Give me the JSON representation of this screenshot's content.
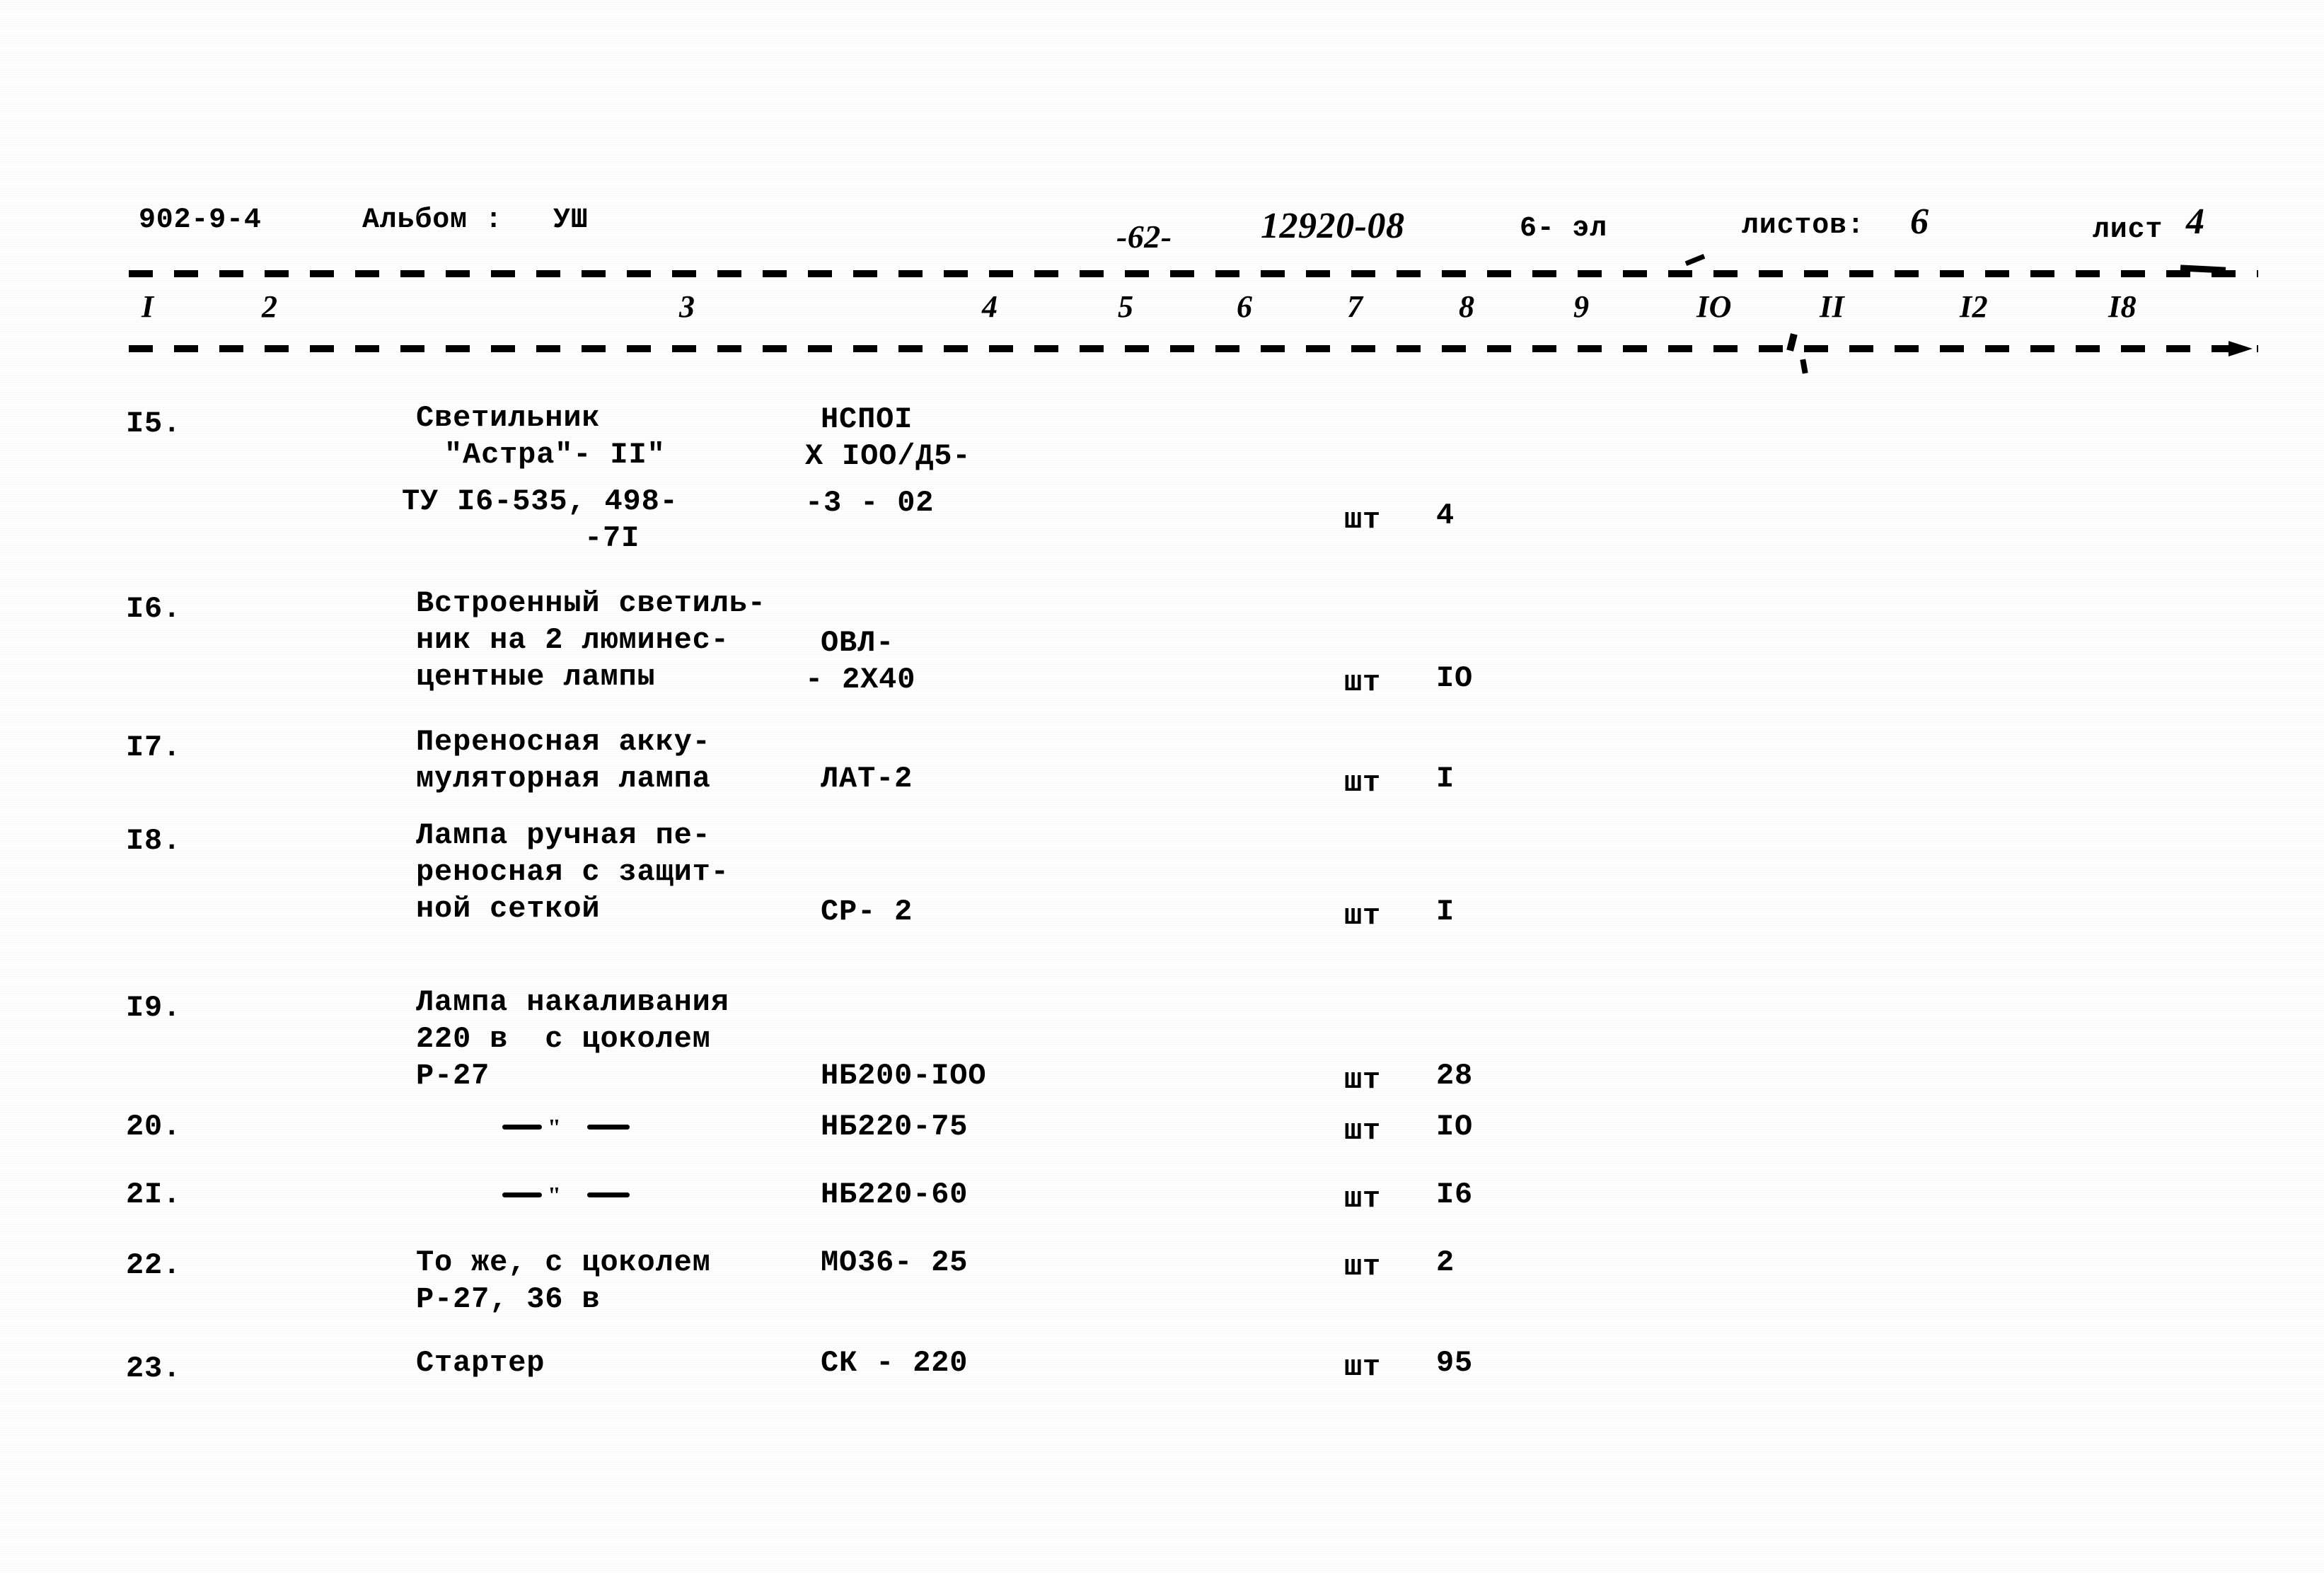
{
  "header": {
    "drawing_code": "902-9-4",
    "album_label": "Альбом :",
    "album_value": "УШ",
    "page_marker": "-62-",
    "order_number": "12920-08",
    "section": "6- эл",
    "sheets_label": "листов:",
    "sheets_value": "6",
    "sheet_label": "лист",
    "sheet_value": "4"
  },
  "column_numbers": [
    "I",
    "2",
    "3",
    "4",
    "5",
    "6",
    "7",
    "8",
    "9",
    "IO",
    "II",
    "I2",
    "I8"
  ],
  "unit_default": "шт",
  "ditto_mark": "\"",
  "rows": [
    {
      "no": "I5.",
      "name_lines": [
        "Светильник",
        "\"Астра\"- II\"",
        "ТУ I6-535, 498-",
        "-7I"
      ],
      "type_lines": [
        "НСПOI",
        "X IOO/Д5-",
        "-3 - 02"
      ],
      "unit": "шт",
      "qty": "4"
    },
    {
      "no": "I6.",
      "name_lines": [
        "Встроенный светиль-",
        "ник на 2 люминес-",
        "центные лампы"
      ],
      "type_lines": [
        "ОВЛ-",
        "- 2Х40"
      ],
      "unit": "шт",
      "qty": "IO"
    },
    {
      "no": "I7.",
      "name_lines": [
        "Переносная акку-",
        "муляторная лампа"
      ],
      "type_lines": [
        "ЛАТ-2"
      ],
      "unit": "шт",
      "qty": "I"
    },
    {
      "no": "I8.",
      "name_lines": [
        "Лампа ручная пе-",
        "реносная с защит-",
        "ной сеткой"
      ],
      "type_lines": [
        "СР- 2"
      ],
      "unit": "шт",
      "qty": "I"
    },
    {
      "no": "I9.",
      "name_lines": [
        "Лампа накаливания",
        "220 в  с цоколем",
        "Р-27"
      ],
      "type_lines": [
        "НБ200-IOO"
      ],
      "unit": "шт",
      "qty": "28"
    },
    {
      "no": "20.",
      "name_lines": [
        "—\"—"
      ],
      "type_lines": [
        "НБ220-75"
      ],
      "unit": "шт",
      "qty": "IO"
    },
    {
      "no": "2I.",
      "name_lines": [
        "—\"—"
      ],
      "type_lines": [
        "НБ220-60"
      ],
      "unit": "шт",
      "qty": "I6"
    },
    {
      "no": "22.",
      "name_lines": [
        "То же, с цоколем",
        "Р-27, 36 в"
      ],
      "type_lines": [
        "МО36- 25"
      ],
      "unit": "шт",
      "qty": "2"
    },
    {
      "no": "23.",
      "name_lines": [
        "Стартер"
      ],
      "type_lines": [
        "СК - 220"
      ],
      "unit": "шт",
      "qty": "95"
    }
  ]
}
